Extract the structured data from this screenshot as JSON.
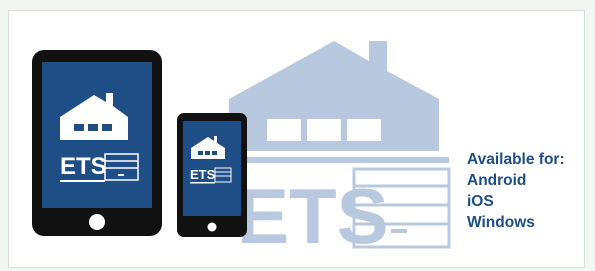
{
  "colors": {
    "ets_blue": "#1f4e87",
    "watermark_blue": "#b8c8de",
    "device_black": "#111111",
    "panel_border": "#cfe3d8"
  },
  "logo": {
    "text": "ETS"
  },
  "availability": {
    "heading": "Available for:",
    "platforms": [
      "Android",
      "iOS",
      "Windows"
    ]
  },
  "icons": [
    "house-icon",
    "garage-door-icon",
    "tablet-icon",
    "smartphone-icon"
  ]
}
